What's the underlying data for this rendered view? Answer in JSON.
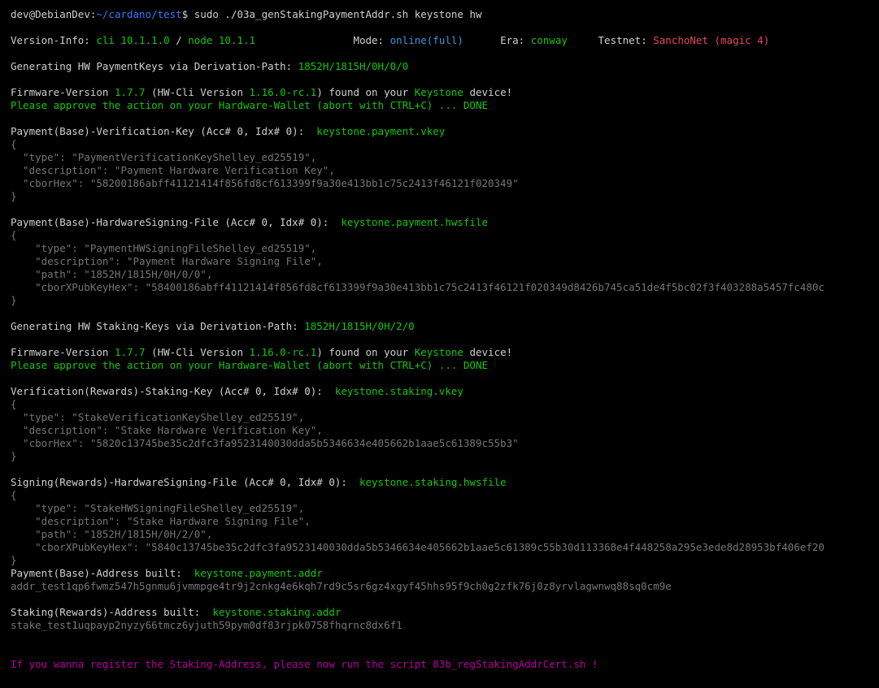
{
  "window": {
    "background": "#000000"
  },
  "colors": {
    "default": "#d0d0d0",
    "green": "#16c60c",
    "cyan": "#3a96dd",
    "red": "#e74856",
    "gray": "#767676",
    "magenta": "#b4009e",
    "path": "#3b78ff"
  },
  "lines": [
    {
      "name": "prompt-line",
      "segs": [
        {
          "t": "dev",
          "c": "white"
        },
        {
          "t": "@",
          "c": "white"
        },
        {
          "t": "DebianDev",
          "c": "white"
        },
        {
          "t": ":",
          "c": "white"
        },
        {
          "t": "~/cardano/test",
          "c": "path"
        },
        {
          "t": "$ sudo ./03a_genStakingPaymentAddr.sh keystone hw",
          "c": "white"
        }
      ]
    },
    {
      "name": "blank",
      "segs": []
    },
    {
      "name": "version-info-line",
      "segs": [
        {
          "t": "Version-Info: ",
          "c": "white"
        },
        {
          "t": "cli 10.1.1.0",
          "c": "green"
        },
        {
          "t": " / ",
          "c": "white"
        },
        {
          "t": "node 10.1.1",
          "c": "green"
        },
        {
          "t": "                Mode: ",
          "c": "white"
        },
        {
          "t": "online(full)",
          "c": "cyan"
        },
        {
          "t": "      Era: ",
          "c": "white"
        },
        {
          "t": "conway",
          "c": "green"
        },
        {
          "t": "     Testnet: ",
          "c": "white"
        },
        {
          "t": "SanchoNet (magic 4)",
          "c": "red"
        }
      ]
    },
    {
      "name": "blank",
      "segs": []
    },
    {
      "name": "gen-payment-keys-line",
      "segs": [
        {
          "t": "Generating HW PaymentKeys via Derivation-Path: ",
          "c": "white"
        },
        {
          "t": "1852H/1815H/0H/0/0",
          "c": "green"
        }
      ]
    },
    {
      "name": "blank",
      "segs": []
    },
    {
      "name": "firmware-line-1",
      "segs": [
        {
          "t": "Firmware-Version ",
          "c": "white"
        },
        {
          "t": "1.7.7",
          "c": "green"
        },
        {
          "t": " (HW-Cli Version ",
          "c": "white"
        },
        {
          "t": "1.16.0-rc.1",
          "c": "green"
        },
        {
          "t": ") found on your ",
          "c": "white"
        },
        {
          "t": "Keystone",
          "c": "green"
        },
        {
          "t": " device!",
          "c": "white"
        }
      ]
    },
    {
      "name": "approve-line-1",
      "segs": [
        {
          "t": "Please approve the action on your Hardware-Wallet (abort with CTRL+C) ... DONE",
          "c": "green"
        }
      ]
    },
    {
      "name": "blank",
      "segs": []
    },
    {
      "name": "payment-vkey-header",
      "segs": [
        {
          "t": "Payment(Base)-Verification-Key (Acc# 0, Idx# 0):  ",
          "c": "white"
        },
        {
          "t": "keystone.payment.vkey",
          "c": "green"
        }
      ]
    },
    {
      "name": "json-line",
      "segs": [
        {
          "t": "{",
          "c": "gray"
        }
      ]
    },
    {
      "name": "json-line",
      "segs": [
        {
          "t": "  \"type\": \"PaymentVerificationKeyShelley_ed25519\",",
          "c": "gray"
        }
      ]
    },
    {
      "name": "json-line",
      "segs": [
        {
          "t": "  \"description\": \"Payment Hardware Verification Key\",",
          "c": "gray"
        }
      ]
    },
    {
      "name": "json-line",
      "segs": [
        {
          "t": "  \"cborHex\": \"58200186abff41121414f856fd8cf613399f9a30e413bb1c75c2413f46121f020349\"",
          "c": "gray"
        }
      ]
    },
    {
      "name": "json-line",
      "segs": [
        {
          "t": "}",
          "c": "gray"
        }
      ]
    },
    {
      "name": "blank",
      "segs": []
    },
    {
      "name": "payment-hwsfile-header",
      "segs": [
        {
          "t": "Payment(Base)-HardwareSigning-File (Acc# 0, Idx# 0):  ",
          "c": "white"
        },
        {
          "t": "keystone.payment.hwsfile",
          "c": "green"
        }
      ]
    },
    {
      "name": "json-line",
      "segs": [
        {
          "t": "{",
          "c": "gray"
        }
      ]
    },
    {
      "name": "json-line",
      "segs": [
        {
          "t": "    \"type\": \"PaymentHWSigningFileShelley_ed25519\",",
          "c": "gray"
        }
      ]
    },
    {
      "name": "json-line",
      "segs": [
        {
          "t": "    \"description\": \"Payment Hardware Signing File\",",
          "c": "gray"
        }
      ]
    },
    {
      "name": "json-line",
      "segs": [
        {
          "t": "    \"path\": \"1852H/1815H/0H/0/0\",",
          "c": "gray"
        }
      ]
    },
    {
      "name": "json-line",
      "segs": [
        {
          "t": "    \"cborXPubKeyHex\": \"58400186abff41121414f856fd8cf613399f9a30e413bb1c75c2413f46121f020349d8426b745ca51de4f5bc02f3f403288a5457fc480c",
          "c": "gray"
        }
      ]
    },
    {
      "name": "json-line",
      "segs": [
        {
          "t": "}",
          "c": "gray"
        }
      ]
    },
    {
      "name": "blank",
      "segs": []
    },
    {
      "name": "gen-staking-keys-line",
      "segs": [
        {
          "t": "Generating HW Staking-Keys via Derivation-Path: ",
          "c": "white"
        },
        {
          "t": "1852H/1815H/0H/2/0",
          "c": "green"
        }
      ]
    },
    {
      "name": "blank",
      "segs": []
    },
    {
      "name": "firmware-line-2",
      "segs": [
        {
          "t": "Firmware-Version ",
          "c": "white"
        },
        {
          "t": "1.7.7",
          "c": "green"
        },
        {
          "t": " (HW-Cli Version ",
          "c": "white"
        },
        {
          "t": "1.16.0-rc.1",
          "c": "green"
        },
        {
          "t": ") found on your ",
          "c": "white"
        },
        {
          "t": "Keystone",
          "c": "green"
        },
        {
          "t": " device!",
          "c": "white"
        }
      ]
    },
    {
      "name": "approve-line-2",
      "segs": [
        {
          "t": "Please approve the action on your Hardware-Wallet (abort with CTRL+C) ... DONE",
          "c": "green"
        }
      ]
    },
    {
      "name": "blank",
      "segs": []
    },
    {
      "name": "staking-vkey-header",
      "segs": [
        {
          "t": "Verification(Rewards)-Staking-Key (Acc# 0, Idx# 0):  ",
          "c": "white"
        },
        {
          "t": "keystone.staking.vkey",
          "c": "green"
        }
      ]
    },
    {
      "name": "json-line",
      "segs": [
        {
          "t": "{",
          "c": "gray"
        }
      ]
    },
    {
      "name": "json-line",
      "segs": [
        {
          "t": "  \"type\": \"StakeVerificationKeyShelley_ed25519\",",
          "c": "gray"
        }
      ]
    },
    {
      "name": "json-line",
      "segs": [
        {
          "t": "  \"description\": \"Stake Hardware Verification Key\",",
          "c": "gray"
        }
      ]
    },
    {
      "name": "json-line",
      "segs": [
        {
          "t": "  \"cborHex\": \"5820c13745be35c2dfc3fa9523140030dda5b5346634e405662b1aae5c61389c55b3\"",
          "c": "gray"
        }
      ]
    },
    {
      "name": "json-line",
      "segs": [
        {
          "t": "}",
          "c": "gray"
        }
      ]
    },
    {
      "name": "blank",
      "segs": []
    },
    {
      "name": "staking-hwsfile-header",
      "segs": [
        {
          "t": "Signing(Rewards)-HardwareSigning-File (Acc# 0, Idx# 0):  ",
          "c": "white"
        },
        {
          "t": "keystone.staking.hwsfile",
          "c": "green"
        }
      ]
    },
    {
      "name": "json-line",
      "segs": [
        {
          "t": "{",
          "c": "gray"
        }
      ]
    },
    {
      "name": "json-line",
      "segs": [
        {
          "t": "    \"type\": \"StakeHWSigningFileShelley_ed25519\",",
          "c": "gray"
        }
      ]
    },
    {
      "name": "json-line",
      "segs": [
        {
          "t": "    \"description\": \"Stake Hardware Signing File\",",
          "c": "gray"
        }
      ]
    },
    {
      "name": "json-line",
      "segs": [
        {
          "t": "    \"path\": \"1852H/1815H/0H/2/0\",",
          "c": "gray"
        }
      ]
    },
    {
      "name": "json-line",
      "segs": [
        {
          "t": "    \"cborXPubKeyHex\": \"5840c13745be35c2dfc3fa9523140030dda5b5346634e405662b1aae5c61389c55b30d113368e4f448258a295e3ede8d28953bf406ef20",
          "c": "gray"
        }
      ]
    },
    {
      "name": "json-line",
      "segs": [
        {
          "t": "}",
          "c": "gray"
        }
      ]
    },
    {
      "name": "payment-addr-header",
      "segs": [
        {
          "t": "Payment(Base)-Address built:  ",
          "c": "white"
        },
        {
          "t": "keystone.payment.addr",
          "c": "green"
        }
      ]
    },
    {
      "name": "payment-addr-value",
      "segs": [
        {
          "t": "addr_test1qp6fwmz547h5gnmu6jvmmpge4tr9j2cnkg4e6kqh7rd9c5sr6gz4xgyf45hhs95f9ch0g2zfk76j0z8yrvlagwnwq88sq0cm9e",
          "c": "gray"
        }
      ]
    },
    {
      "name": "blank",
      "segs": []
    },
    {
      "name": "staking-addr-header",
      "segs": [
        {
          "t": "Staking(Rewards)-Address built:  ",
          "c": "white"
        },
        {
          "t": "keystone.staking.addr",
          "c": "green"
        }
      ]
    },
    {
      "name": "staking-addr-value",
      "segs": [
        {
          "t": "stake_test1uqpayp2nyzy66tmcz6yjuth59pym0df83rjpk0758fhqrnc8dx6f1",
          "c": "gray"
        }
      ]
    },
    {
      "name": "blank",
      "segs": []
    },
    {
      "name": "blank",
      "segs": []
    },
    {
      "name": "register-hint-line",
      "segs": [
        {
          "t": "If you wanna register the Staking-Address, please now run the script 03b_regStakingAddrCert.sh !",
          "c": "magenta"
        }
      ]
    }
  ]
}
